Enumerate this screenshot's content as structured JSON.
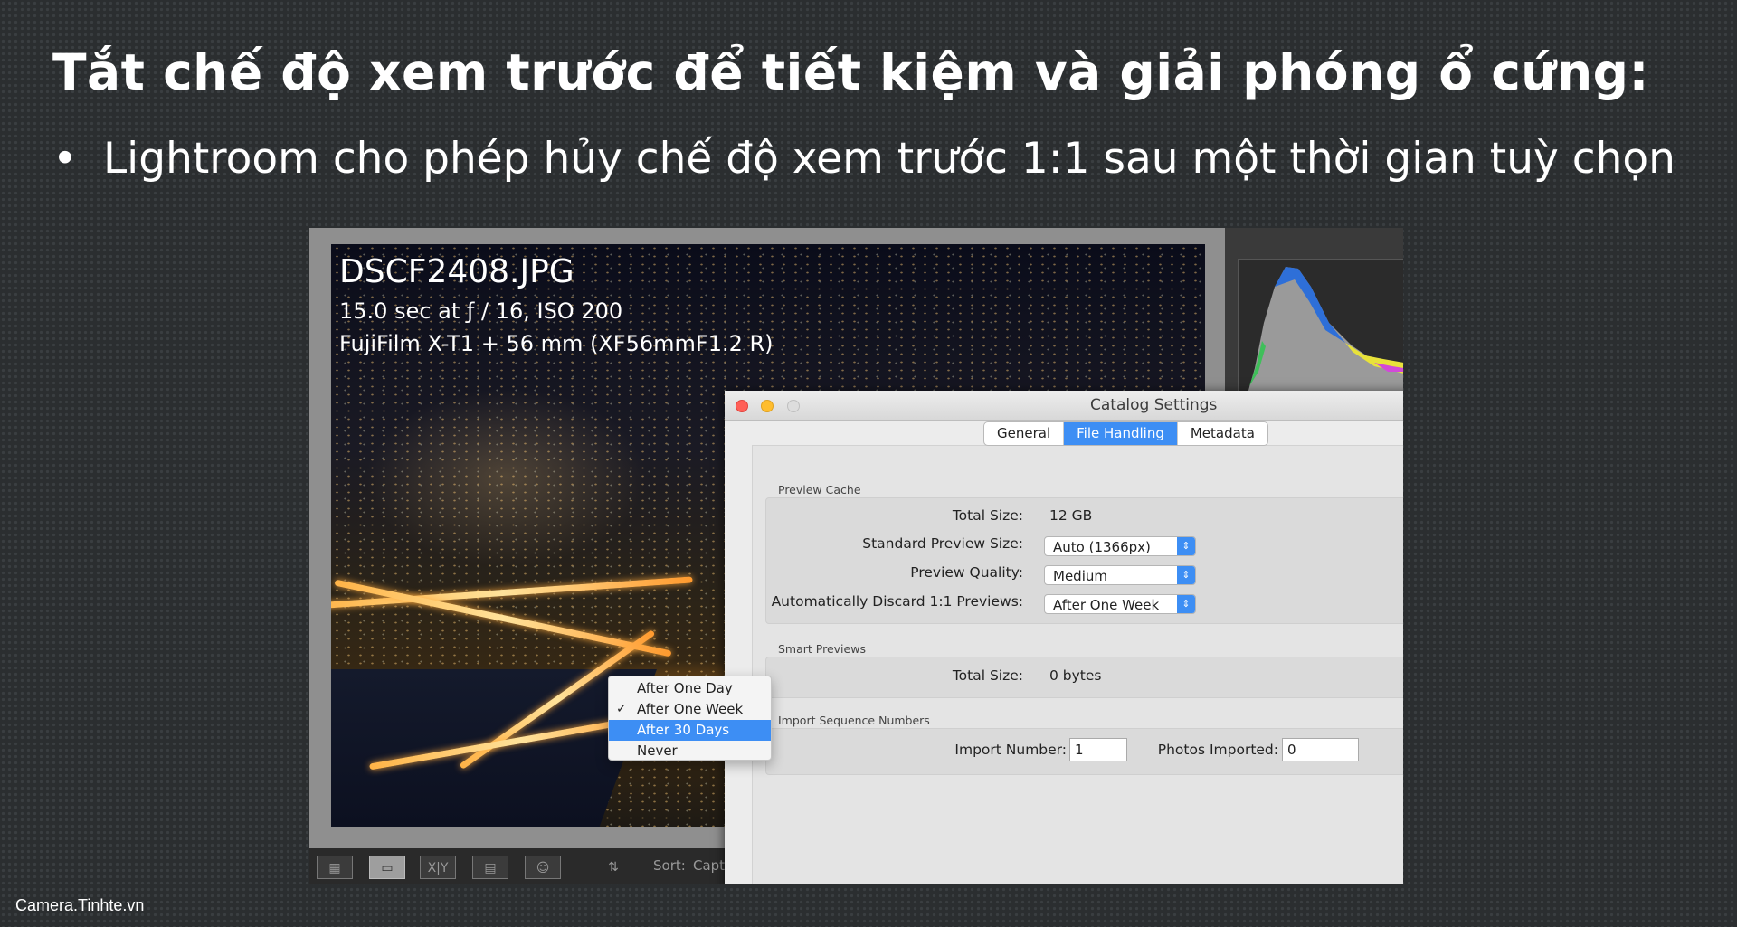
{
  "slide": {
    "title": "Tắt chế độ xem trước để tiết kiệm và giải phóng ổ cứng:",
    "bullet_symbol": "•",
    "bullet_text": "Lightroom cho phép hủy chế độ xem trước 1:1 sau một thời gian tuỳ chọn"
  },
  "photo": {
    "filename": "DSCF2408.JPG",
    "exposure": "15.0 sec at ƒ / 16, ISO 200",
    "camera": "FujiFilm X-T1 + 56 mm (XF56mmF1.2 R)"
  },
  "toolbar": {
    "icons": [
      "grid-view-icon",
      "loupe-view-icon",
      "compare-view-icon",
      "survey-view-icon",
      "people-view-icon"
    ],
    "compare_label": "X|Y",
    "sort_label": "Sort:",
    "sort_value": "Capt"
  },
  "dialog": {
    "title": "Catalog Settings",
    "tabs": [
      {
        "label": "General",
        "active": false
      },
      {
        "label": "File Handling",
        "active": true
      },
      {
        "label": "Metadata",
        "active": false
      }
    ],
    "preview_cache": {
      "section_label": "Preview Cache",
      "total_size_label": "Total Size:",
      "total_size_value": "12 GB",
      "standard_preview_size_label": "Standard Preview Size:",
      "standard_preview_size_value": "Auto (1366px)",
      "preview_quality_label": "Preview Quality:",
      "preview_quality_value": "Medium",
      "discard_label": "Automatically Discard 1:1 Previews:",
      "discard_value": "After One Week"
    },
    "discard_menu": {
      "options": [
        "After One Day",
        "After One Week",
        "After 30 Days",
        "Never"
      ],
      "checked": "After One Week",
      "highlighted": "After 30 Days",
      "check_mark": "✓"
    },
    "smart_previews": {
      "section_label": "Smart Previews",
      "total_size_label": "Total Size:",
      "total_size_value": "0 bytes"
    },
    "import_sequence": {
      "section_label": "Import Sequence Numbers",
      "import_number_label": "Import Number:",
      "import_number_value": "1",
      "photos_imported_label": "Photos Imported:",
      "photos_imported_value": "0"
    }
  },
  "watermark": "Camera.Tinhte.vn",
  "colors": {
    "accent": "#3d8ef4",
    "close": "#ff5f57",
    "minimize": "#ffbd2e",
    "zoom": "#dddddd",
    "slide_background": "#2b2e30"
  }
}
